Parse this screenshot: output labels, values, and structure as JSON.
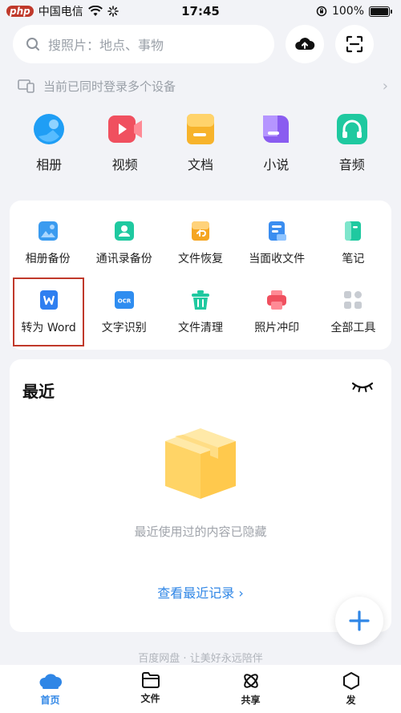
{
  "status_bar": {
    "badge": "php",
    "carrier": "中国电信",
    "time": "17:45",
    "battery": "100%",
    "battery_level": 1.0
  },
  "search": {
    "placeholder": "搜照片：地点、事物"
  },
  "device_tip": {
    "text": "当前已同时登录多个设备"
  },
  "categories": [
    {
      "label": "相册",
      "icon": "album-icon",
      "color": "#1f9ef5"
    },
    {
      "label": "视频",
      "icon": "video-icon",
      "color": "#f0505f"
    },
    {
      "label": "文档",
      "icon": "document-icon",
      "color": "#f7b32b"
    },
    {
      "label": "小说",
      "icon": "novel-icon",
      "color": "#8a5cf0"
    },
    {
      "label": "音频",
      "icon": "audio-icon",
      "color": "#1fc9a0"
    }
  ],
  "tools": [
    {
      "label": "相册备份",
      "icon": "album-backup-icon",
      "color": "#3a9bf0"
    },
    {
      "label": "通讯录备份",
      "icon": "contacts-backup-icon",
      "color": "#1fc9a0"
    },
    {
      "label": "文件恢复",
      "icon": "file-restore-icon",
      "color": "#f5a623"
    },
    {
      "label": "当面收文件",
      "icon": "receive-file-icon",
      "color": "#3a8df0"
    },
    {
      "label": "笔记",
      "icon": "note-icon",
      "color": "#1fc9a0"
    },
    {
      "label": "转为 Word",
      "icon": "word-convert-icon",
      "color": "#2f7ff0"
    },
    {
      "label": "文字识别",
      "icon": "ocr-icon",
      "color": "#2f8df0"
    },
    {
      "label": "文件清理",
      "icon": "file-clean-icon",
      "color": "#1fc9a0"
    },
    {
      "label": "照片冲印",
      "icon": "photo-print-icon",
      "color": "#f0505f"
    },
    {
      "label": "全部工具",
      "icon": "all-tools-icon",
      "color": "#c8ccd2"
    }
  ],
  "recent": {
    "title": "最近",
    "empty_text": "最近使用过的内容已隐藏",
    "link": "查看最近记录 ›"
  },
  "slogan": "百度网盘 · 让美好永远陪伴",
  "tabbar": [
    {
      "label": "首页",
      "icon": "home-icon",
      "active": true
    },
    {
      "label": "文件",
      "icon": "folder-icon",
      "active": false
    },
    {
      "label": "共享",
      "icon": "share-icon",
      "active": false
    },
    {
      "label": "发",
      "icon": "discover-icon",
      "active": false
    }
  ],
  "colors": {
    "accent": "#2f86e6",
    "highlight_border": "#c0392b"
  }
}
